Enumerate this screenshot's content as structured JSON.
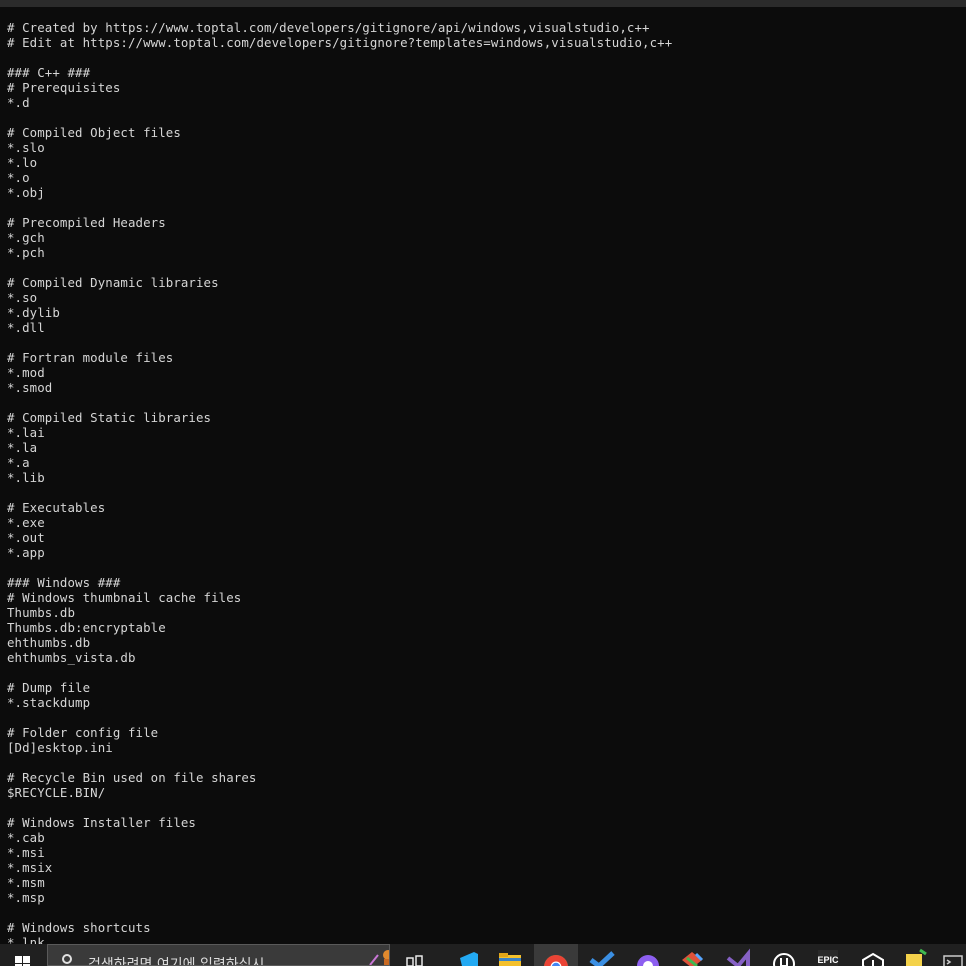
{
  "terminal": {
    "lines": [
      "# Created by https://www.toptal.com/developers/gitignore/api/windows,visualstudio,c++",
      "# Edit at https://www.toptal.com/developers/gitignore?templates=windows,visualstudio,c++",
      "",
      "### C++ ###",
      "# Prerequisites",
      "*.d",
      "",
      "# Compiled Object files",
      "*.slo",
      "*.lo",
      "*.o",
      "*.obj",
      "",
      "# Precompiled Headers",
      "*.gch",
      "*.pch",
      "",
      "# Compiled Dynamic libraries",
      "*.so",
      "*.dylib",
      "*.dll",
      "",
      "# Fortran module files",
      "*.mod",
      "*.smod",
      "",
      "# Compiled Static libraries",
      "*.lai",
      "*.la",
      "*.a",
      "*.lib",
      "",
      "# Executables",
      "*.exe",
      "*.out",
      "*.app",
      "",
      "### Windows ###",
      "# Windows thumbnail cache files",
      "Thumbs.db",
      "Thumbs.db:encryptable",
      "ehthumbs.db",
      "ehthumbs_vista.db",
      "",
      "# Dump file",
      "*.stackdump",
      "",
      "# Folder config file",
      "[Dd]esktop.ini",
      "",
      "# Recycle Bin used on file shares",
      "$RECYCLE.BIN/",
      "",
      "# Windows Installer files",
      "*.cab",
      "*.msi",
      "*.msix",
      "*.msm",
      "*.msp",
      "",
      "# Windows shortcuts",
      "*.lnk"
    ]
  },
  "taskbar": {
    "search_placeholder": "검색하려면 여기에 입력하십시",
    "epic_label": "EPIC",
    "icons": [
      "windows-start-icon",
      "task-view-icon",
      "visual-studio-code-icon",
      "file-explorer-icon",
      "chrome-icon",
      "visual-studio-check-icon",
      "github-desktop-icon",
      "git-icon",
      "visual-studio-icon",
      "unreal-engine-icon",
      "epic-games-icon",
      "unity-icon",
      "notes-icon",
      "terminal-icon"
    ],
    "colors": {
      "background": "#202020",
      "search_bg": "#3a3a3a",
      "vscode": "#23a9f2",
      "explorer": "#f5c02b",
      "chrome_red": "#ea4335",
      "chrome_green": "#34a853",
      "chrome_yellow": "#fbbc04",
      "chrome_blue": "#4285f4",
      "vs_check": "#3b8fe3",
      "github_purple": "#8d5ff0",
      "git_orange": "#e0523a",
      "vs_purple": "#8661c5"
    }
  }
}
